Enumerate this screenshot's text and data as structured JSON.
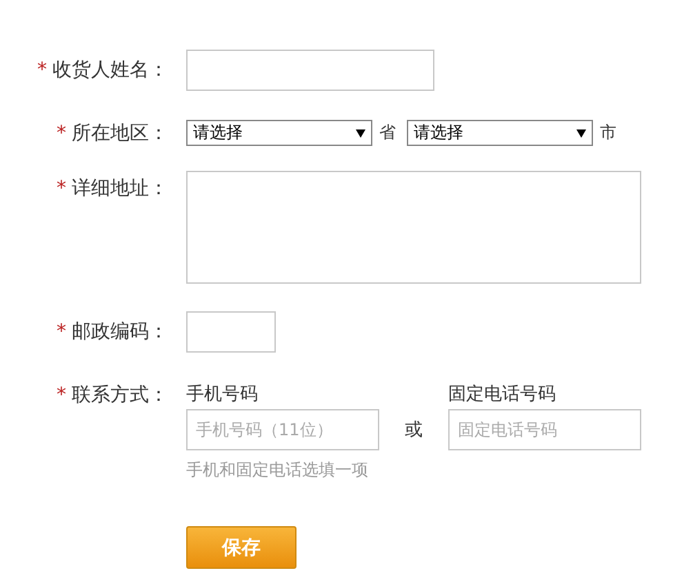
{
  "fields": [
    {
      "kind": "text",
      "mark": "*",
      "label": "收货人姓名："
    },
    {
      "kind": "region",
      "mark": "*",
      "label": "所在地区：",
      "selects": [
        {
          "value": "请选择",
          "unit": "省"
        },
        {
          "value": "请选择",
          "unit": "市"
        }
      ]
    },
    {
      "kind": "textarea",
      "mark": "*",
      "label": "详细地址："
    },
    {
      "kind": "short",
      "mark": "*",
      "label": "邮政编码："
    },
    {
      "kind": "contact",
      "mark": "*",
      "label": "联系方式：",
      "columns": [
        {
          "heading": "手机号码",
          "placeholder": "手机号码（11位）"
        },
        {
          "heading": "固定电话号码",
          "placeholder": "固定电话号码"
        }
      ],
      "separator": "或",
      "hint": "手机和固定电话选填一项"
    }
  ],
  "save_button": "保存"
}
